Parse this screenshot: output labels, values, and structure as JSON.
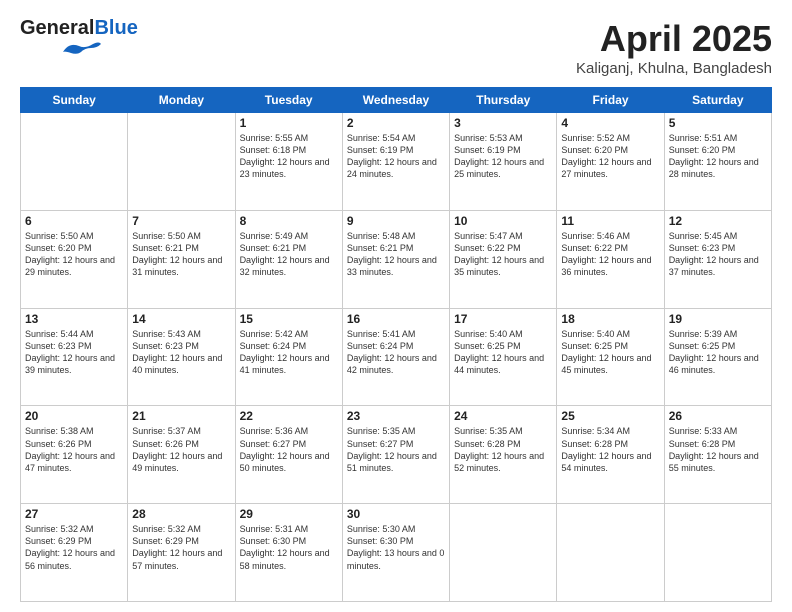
{
  "header": {
    "logo_general": "General",
    "logo_blue": "Blue",
    "main_title": "April 2025",
    "subtitle": "Kaliganj, Khulna, Bangladesh"
  },
  "days_of_week": [
    "Sunday",
    "Monday",
    "Tuesday",
    "Wednesday",
    "Thursday",
    "Friday",
    "Saturday"
  ],
  "weeks": [
    [
      {
        "day": "",
        "sunrise": "",
        "sunset": "",
        "daylight": ""
      },
      {
        "day": "",
        "sunrise": "",
        "sunset": "",
        "daylight": ""
      },
      {
        "day": "1",
        "sunrise": "Sunrise: 5:55 AM",
        "sunset": "Sunset: 6:18 PM",
        "daylight": "Daylight: 12 hours and 23 minutes."
      },
      {
        "day": "2",
        "sunrise": "Sunrise: 5:54 AM",
        "sunset": "Sunset: 6:19 PM",
        "daylight": "Daylight: 12 hours and 24 minutes."
      },
      {
        "day": "3",
        "sunrise": "Sunrise: 5:53 AM",
        "sunset": "Sunset: 6:19 PM",
        "daylight": "Daylight: 12 hours and 25 minutes."
      },
      {
        "day": "4",
        "sunrise": "Sunrise: 5:52 AM",
        "sunset": "Sunset: 6:20 PM",
        "daylight": "Daylight: 12 hours and 27 minutes."
      },
      {
        "day": "5",
        "sunrise": "Sunrise: 5:51 AM",
        "sunset": "Sunset: 6:20 PM",
        "daylight": "Daylight: 12 hours and 28 minutes."
      }
    ],
    [
      {
        "day": "6",
        "sunrise": "Sunrise: 5:50 AM",
        "sunset": "Sunset: 6:20 PM",
        "daylight": "Daylight: 12 hours and 29 minutes."
      },
      {
        "day": "7",
        "sunrise": "Sunrise: 5:50 AM",
        "sunset": "Sunset: 6:21 PM",
        "daylight": "Daylight: 12 hours and 31 minutes."
      },
      {
        "day": "8",
        "sunrise": "Sunrise: 5:49 AM",
        "sunset": "Sunset: 6:21 PM",
        "daylight": "Daylight: 12 hours and 32 minutes."
      },
      {
        "day": "9",
        "sunrise": "Sunrise: 5:48 AM",
        "sunset": "Sunset: 6:21 PM",
        "daylight": "Daylight: 12 hours and 33 minutes."
      },
      {
        "day": "10",
        "sunrise": "Sunrise: 5:47 AM",
        "sunset": "Sunset: 6:22 PM",
        "daylight": "Daylight: 12 hours and 35 minutes."
      },
      {
        "day": "11",
        "sunrise": "Sunrise: 5:46 AM",
        "sunset": "Sunset: 6:22 PM",
        "daylight": "Daylight: 12 hours and 36 minutes."
      },
      {
        "day": "12",
        "sunrise": "Sunrise: 5:45 AM",
        "sunset": "Sunset: 6:23 PM",
        "daylight": "Daylight: 12 hours and 37 minutes."
      }
    ],
    [
      {
        "day": "13",
        "sunrise": "Sunrise: 5:44 AM",
        "sunset": "Sunset: 6:23 PM",
        "daylight": "Daylight: 12 hours and 39 minutes."
      },
      {
        "day": "14",
        "sunrise": "Sunrise: 5:43 AM",
        "sunset": "Sunset: 6:23 PM",
        "daylight": "Daylight: 12 hours and 40 minutes."
      },
      {
        "day": "15",
        "sunrise": "Sunrise: 5:42 AM",
        "sunset": "Sunset: 6:24 PM",
        "daylight": "Daylight: 12 hours and 41 minutes."
      },
      {
        "day": "16",
        "sunrise": "Sunrise: 5:41 AM",
        "sunset": "Sunset: 6:24 PM",
        "daylight": "Daylight: 12 hours and 42 minutes."
      },
      {
        "day": "17",
        "sunrise": "Sunrise: 5:40 AM",
        "sunset": "Sunset: 6:25 PM",
        "daylight": "Daylight: 12 hours and 44 minutes."
      },
      {
        "day": "18",
        "sunrise": "Sunrise: 5:40 AM",
        "sunset": "Sunset: 6:25 PM",
        "daylight": "Daylight: 12 hours and 45 minutes."
      },
      {
        "day": "19",
        "sunrise": "Sunrise: 5:39 AM",
        "sunset": "Sunset: 6:25 PM",
        "daylight": "Daylight: 12 hours and 46 minutes."
      }
    ],
    [
      {
        "day": "20",
        "sunrise": "Sunrise: 5:38 AM",
        "sunset": "Sunset: 6:26 PM",
        "daylight": "Daylight: 12 hours and 47 minutes."
      },
      {
        "day": "21",
        "sunrise": "Sunrise: 5:37 AM",
        "sunset": "Sunset: 6:26 PM",
        "daylight": "Daylight: 12 hours and 49 minutes."
      },
      {
        "day": "22",
        "sunrise": "Sunrise: 5:36 AM",
        "sunset": "Sunset: 6:27 PM",
        "daylight": "Daylight: 12 hours and 50 minutes."
      },
      {
        "day": "23",
        "sunrise": "Sunrise: 5:35 AM",
        "sunset": "Sunset: 6:27 PM",
        "daylight": "Daylight: 12 hours and 51 minutes."
      },
      {
        "day": "24",
        "sunrise": "Sunrise: 5:35 AM",
        "sunset": "Sunset: 6:28 PM",
        "daylight": "Daylight: 12 hours and 52 minutes."
      },
      {
        "day": "25",
        "sunrise": "Sunrise: 5:34 AM",
        "sunset": "Sunset: 6:28 PM",
        "daylight": "Daylight: 12 hours and 54 minutes."
      },
      {
        "day": "26",
        "sunrise": "Sunrise: 5:33 AM",
        "sunset": "Sunset: 6:28 PM",
        "daylight": "Daylight: 12 hours and 55 minutes."
      }
    ],
    [
      {
        "day": "27",
        "sunrise": "Sunrise: 5:32 AM",
        "sunset": "Sunset: 6:29 PM",
        "daylight": "Daylight: 12 hours and 56 minutes."
      },
      {
        "day": "28",
        "sunrise": "Sunrise: 5:32 AM",
        "sunset": "Sunset: 6:29 PM",
        "daylight": "Daylight: 12 hours and 57 minutes."
      },
      {
        "day": "29",
        "sunrise": "Sunrise: 5:31 AM",
        "sunset": "Sunset: 6:30 PM",
        "daylight": "Daylight: 12 hours and 58 minutes."
      },
      {
        "day": "30",
        "sunrise": "Sunrise: 5:30 AM",
        "sunset": "Sunset: 6:30 PM",
        "daylight": "Daylight: 13 hours and 0 minutes."
      },
      {
        "day": "",
        "sunrise": "",
        "sunset": "",
        "daylight": ""
      },
      {
        "day": "",
        "sunrise": "",
        "sunset": "",
        "daylight": ""
      },
      {
        "day": "",
        "sunrise": "",
        "sunset": "",
        "daylight": ""
      }
    ]
  ]
}
